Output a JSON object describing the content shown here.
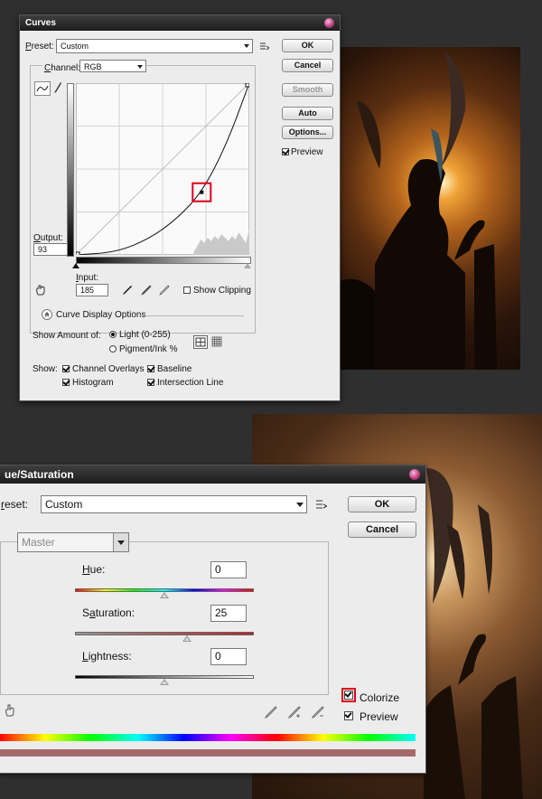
{
  "curves": {
    "title": "Curves",
    "preset_label": "Preset:",
    "preset_value": "Custom",
    "ok": "OK",
    "cancel": "Cancel",
    "smooth": "Smooth",
    "auto": "Auto",
    "options": "Options...",
    "preview": "Preview",
    "preview_checked": true,
    "channel_label": "Channel:",
    "channel_value": "RGB",
    "output_label": "Output:",
    "output_value": "93",
    "input_label": "Input:",
    "input_value": "185",
    "show_clipping": "Show Clipping",
    "show_clipping_checked": false,
    "display_options": "Curve Display Options",
    "show_amount_label": "Show Amount of:",
    "light_option": "Light  (0-255)",
    "pigment_option": "Pigment/Ink %",
    "amount_selected": "light",
    "show_label": "Show:",
    "channel_overlays": "Channel Overlays",
    "baseline": "Baseline",
    "histogram": "Histogram",
    "intersection_line": "Intersection Line",
    "checks": {
      "channel_overlays": true,
      "baseline": true,
      "histogram": true,
      "intersection_line": true
    },
    "curve_points": [
      [
        0,
        0
      ],
      [
        60,
        4
      ],
      [
        110,
        25
      ],
      [
        150,
        55
      ],
      [
        185,
        93
      ],
      [
        220,
        160
      ],
      [
        255,
        255
      ]
    ],
    "selected_point": [
      185,
      93
    ]
  },
  "hue_saturation": {
    "title": "ue/Saturation",
    "preset_label": "reset:",
    "preset_value": "Custom",
    "ok": "OK",
    "cancel": "Cancel",
    "edit_value": "Master",
    "hue_label": "Hue:",
    "hue_value": "0",
    "hue_slider": 0,
    "saturation_label": "Saturation:",
    "saturation_value": "25",
    "saturation_slider": 25,
    "lightness_label": "Lightness:",
    "lightness_value": "0",
    "lightness_slider": 0,
    "colorize": "Colorize",
    "colorize_checked": true,
    "preview": "Preview",
    "preview_checked": true
  },
  "colors": {
    "highlight": "#e0001b",
    "dialog_bg": "#ececec",
    "app_bg": "#2f2f2f"
  }
}
